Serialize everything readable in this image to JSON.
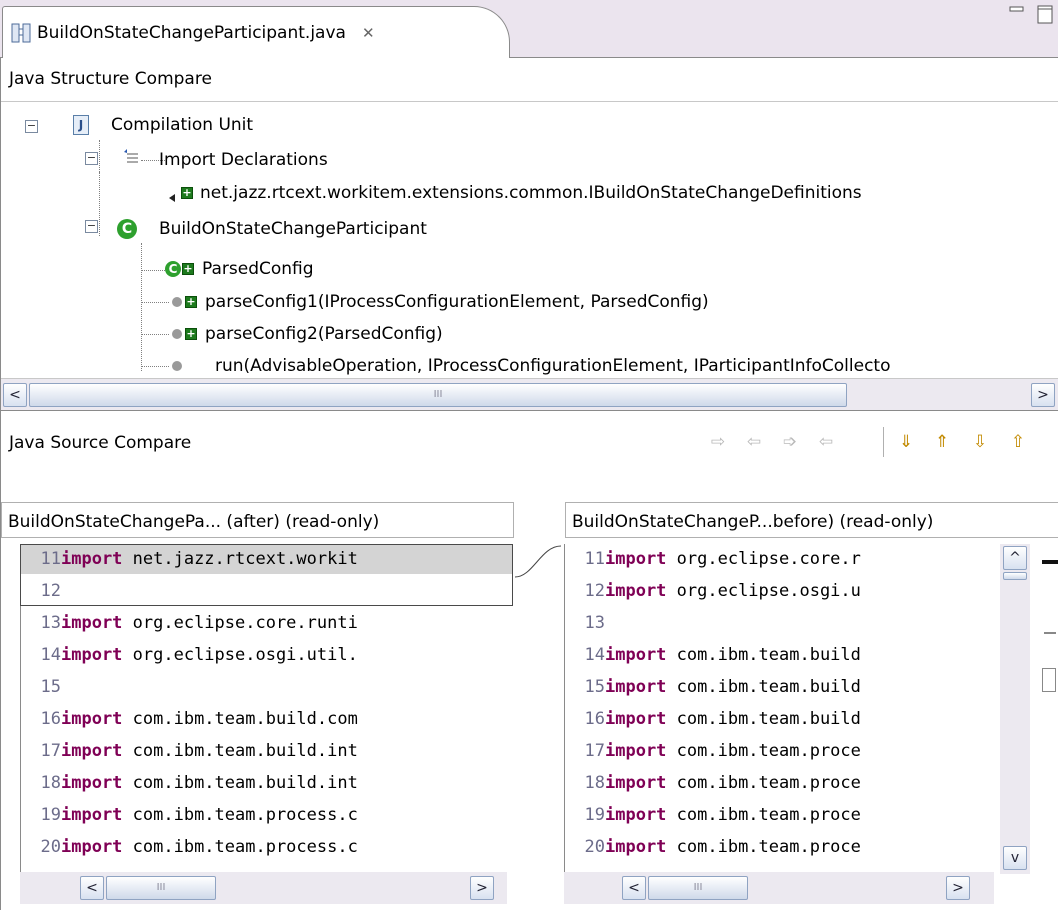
{
  "editor_tab": {
    "title": "BuildOnStateChangeParticipant.java",
    "close_glyph": "✕"
  },
  "structure": {
    "title": "Java Structure Compare",
    "tree": [
      {
        "label": "Compilation Unit",
        "icon": "java-file-icon"
      },
      {
        "label": "Import Declarations",
        "icon": "imports-icon"
      },
      {
        "label": "net.jazz.rtcext.workitem.extensions.common.IBuildOnStateChangeDefinitions",
        "icon": "import-added-icon"
      },
      {
        "label": "BuildOnStateChangeParticipant",
        "icon": "class-icon"
      },
      {
        "label": "ParsedConfig",
        "icon": "inner-class-added-icon"
      },
      {
        "label": "parseConfig1(IProcessConfigurationElement, ParsedConfig)",
        "icon": "method-added-icon"
      },
      {
        "label": "parseConfig2(ParsedConfig)",
        "icon": "method-added-icon"
      },
      {
        "label": "run(AdvisableOperation, IProcessConfigurationElement, IParticipantInfoCollecto",
        "icon": "method-icon"
      }
    ]
  },
  "source": {
    "title": "Java Source Compare",
    "left_pane": {
      "title": "BuildOnStateChangePa... (after) (read-only)",
      "lines": [
        {
          "n": "11",
          "kw": "import",
          "rest": " net.jazz.rtcext.workit"
        },
        {
          "n": "12",
          "kw": "",
          "rest": ""
        },
        {
          "n": "13",
          "kw": "import",
          "rest": " org.eclipse.core.runti"
        },
        {
          "n": "14",
          "kw": "import",
          "rest": " org.eclipse.osgi.util."
        },
        {
          "n": "15",
          "kw": "",
          "rest": ""
        },
        {
          "n": "16",
          "kw": "import",
          "rest": " com.ibm.team.build.com"
        },
        {
          "n": "17",
          "kw": "import",
          "rest": " com.ibm.team.build.int"
        },
        {
          "n": "18",
          "kw": "import",
          "rest": " com.ibm.team.build.int"
        },
        {
          "n": "19",
          "kw": "import",
          "rest": " com.ibm.team.process.c"
        },
        {
          "n": "20",
          "kw": "import",
          "rest": " com.ibm.team.process.c"
        }
      ]
    },
    "right_pane": {
      "title": "BuildOnStateChangeP...before) (read-only)",
      "lines": [
        {
          "n": "11",
          "kw": "import",
          "rest": " org.eclipse.core.r"
        },
        {
          "n": "12",
          "kw": "import",
          "rest": " org.eclipse.osgi.u"
        },
        {
          "n": "13",
          "kw": "",
          "rest": ""
        },
        {
          "n": "14",
          "kw": "import",
          "rest": " com.ibm.team.build"
        },
        {
          "n": "15",
          "kw": "import",
          "rest": " com.ibm.team.build"
        },
        {
          "n": "16",
          "kw": "import",
          "rest": " com.ibm.team.build"
        },
        {
          "n": "17",
          "kw": "import",
          "rest": " com.ibm.team.proce"
        },
        {
          "n": "18",
          "kw": "import",
          "rest": " com.ibm.team.proce"
        },
        {
          "n": "19",
          "kw": "import",
          "rest": " com.ibm.team.proce"
        },
        {
          "n": "20",
          "kw": "import",
          "rest": " com.ibm.team.proce"
        }
      ]
    },
    "toolbar": [
      {
        "name": "copy-all-right-icon",
        "glyph": "⇨",
        "enabled": false
      },
      {
        "name": "copy-all-left-icon",
        "glyph": "⇦",
        "enabled": false
      },
      {
        "name": "copy-right-icon",
        "glyph": "➩",
        "enabled": false
      },
      {
        "name": "copy-left-icon",
        "glyph": "⇦",
        "enabled": false
      },
      {
        "name": "next-difference-icon",
        "glyph": "⇓",
        "enabled": true
      },
      {
        "name": "previous-difference-icon",
        "glyph": "⇑",
        "enabled": true
      },
      {
        "name": "next-change-icon",
        "glyph": "⇩",
        "enabled": true
      },
      {
        "name": "previous-change-icon",
        "glyph": "⇧",
        "enabled": true
      }
    ]
  },
  "scroll_glyphs": {
    "left": "<",
    "right": ">",
    "up": "^",
    "down": "v",
    "grip": "III"
  },
  "colors": {
    "keyword": "#7f0055",
    "line_number": "#6c6c8a",
    "tab_strip": "#ebe4ee",
    "diff_highlight": "#d4d4d4"
  }
}
